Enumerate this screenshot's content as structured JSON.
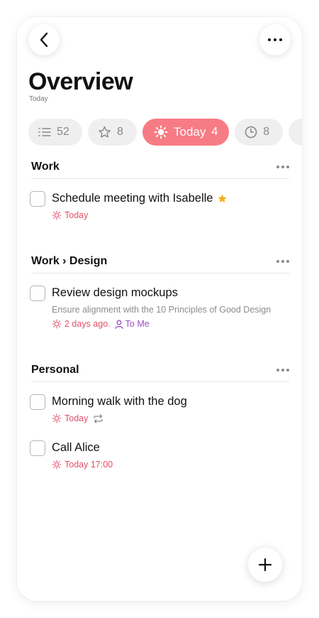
{
  "header": {
    "title": "Overview",
    "subtitle": "Today"
  },
  "filters": [
    {
      "id": "all",
      "icon": "list-icon",
      "count": "52"
    },
    {
      "id": "starred",
      "icon": "star-icon",
      "count": "8"
    },
    {
      "id": "today",
      "icon": "sun-icon",
      "label": "Today",
      "count": "4",
      "active": true
    },
    {
      "id": "scheduled",
      "icon": "clock-icon",
      "count": "8"
    }
  ],
  "sections": [
    {
      "title": "Work",
      "tasks": [
        {
          "title": "Schedule meeting with Isabelle",
          "starred": true,
          "due": "Today"
        }
      ]
    },
    {
      "title": "Work › Design",
      "tasks": [
        {
          "title": "Review design mockups",
          "note": "Ensure alignment with the 10 Principles of Good Design",
          "due": "2 days ago.",
          "assignee": "To Me"
        }
      ]
    },
    {
      "title": "Personal",
      "tasks": [
        {
          "title": "Morning walk with the dog",
          "due": "Today",
          "repeat": true
        },
        {
          "title": "Call Alice",
          "due": "Today 17:00"
        }
      ]
    }
  ],
  "colors": {
    "accent": "#f77b84",
    "due": "#e0506a",
    "assignee": "#9b4fc9",
    "star": "#f2b01e"
  }
}
